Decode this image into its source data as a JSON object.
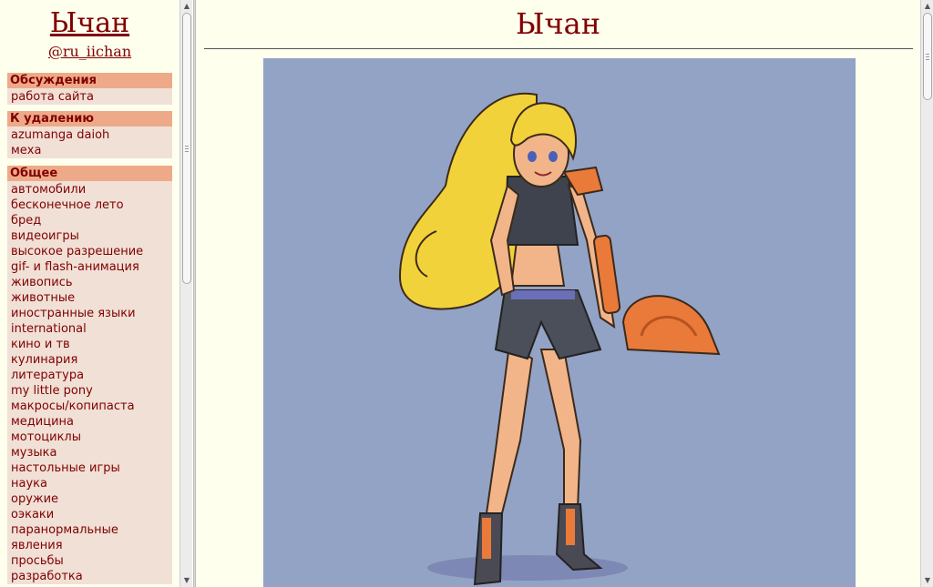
{
  "sidebar": {
    "site_title": "Ычан",
    "site_handle": "@ru_iichan",
    "sections": [
      {
        "header": "Обсуждения",
        "items": [
          "работа сайта"
        ]
      },
      {
        "header": "К удалению",
        "items": [
          "azumanga daioh",
          "меха"
        ]
      },
      {
        "header": "Общее",
        "items": [
          "автомобили",
          "бесконечное лето",
          "бред",
          "видеоигры",
          "высокое разрешение",
          "gif- и flash-анимация",
          "живопись",
          "животные",
          "иностранные языки",
          "international",
          "кино и тв",
          "кулинария",
          "литература",
          "my little pony",
          "макросы/копипаста",
          "медицина",
          "мотоциклы",
          "музыка",
          "настольные игры",
          "наука",
          "оружие",
          "оэкаки",
          "паранормальные",
          "явления",
          "просьбы",
          "разработка"
        ]
      }
    ]
  },
  "main": {
    "title": "Ычан"
  },
  "colors": {
    "background": "#ffffee",
    "link": "#800000",
    "menu_header_bg": "#eeaa88",
    "menu_list_bg": "#f0e0d6",
    "banner_bg": "#93a3c5"
  },
  "icons": {
    "scroll_up": "scroll-up-arrow",
    "scroll_down": "scroll-down-arrow"
  }
}
